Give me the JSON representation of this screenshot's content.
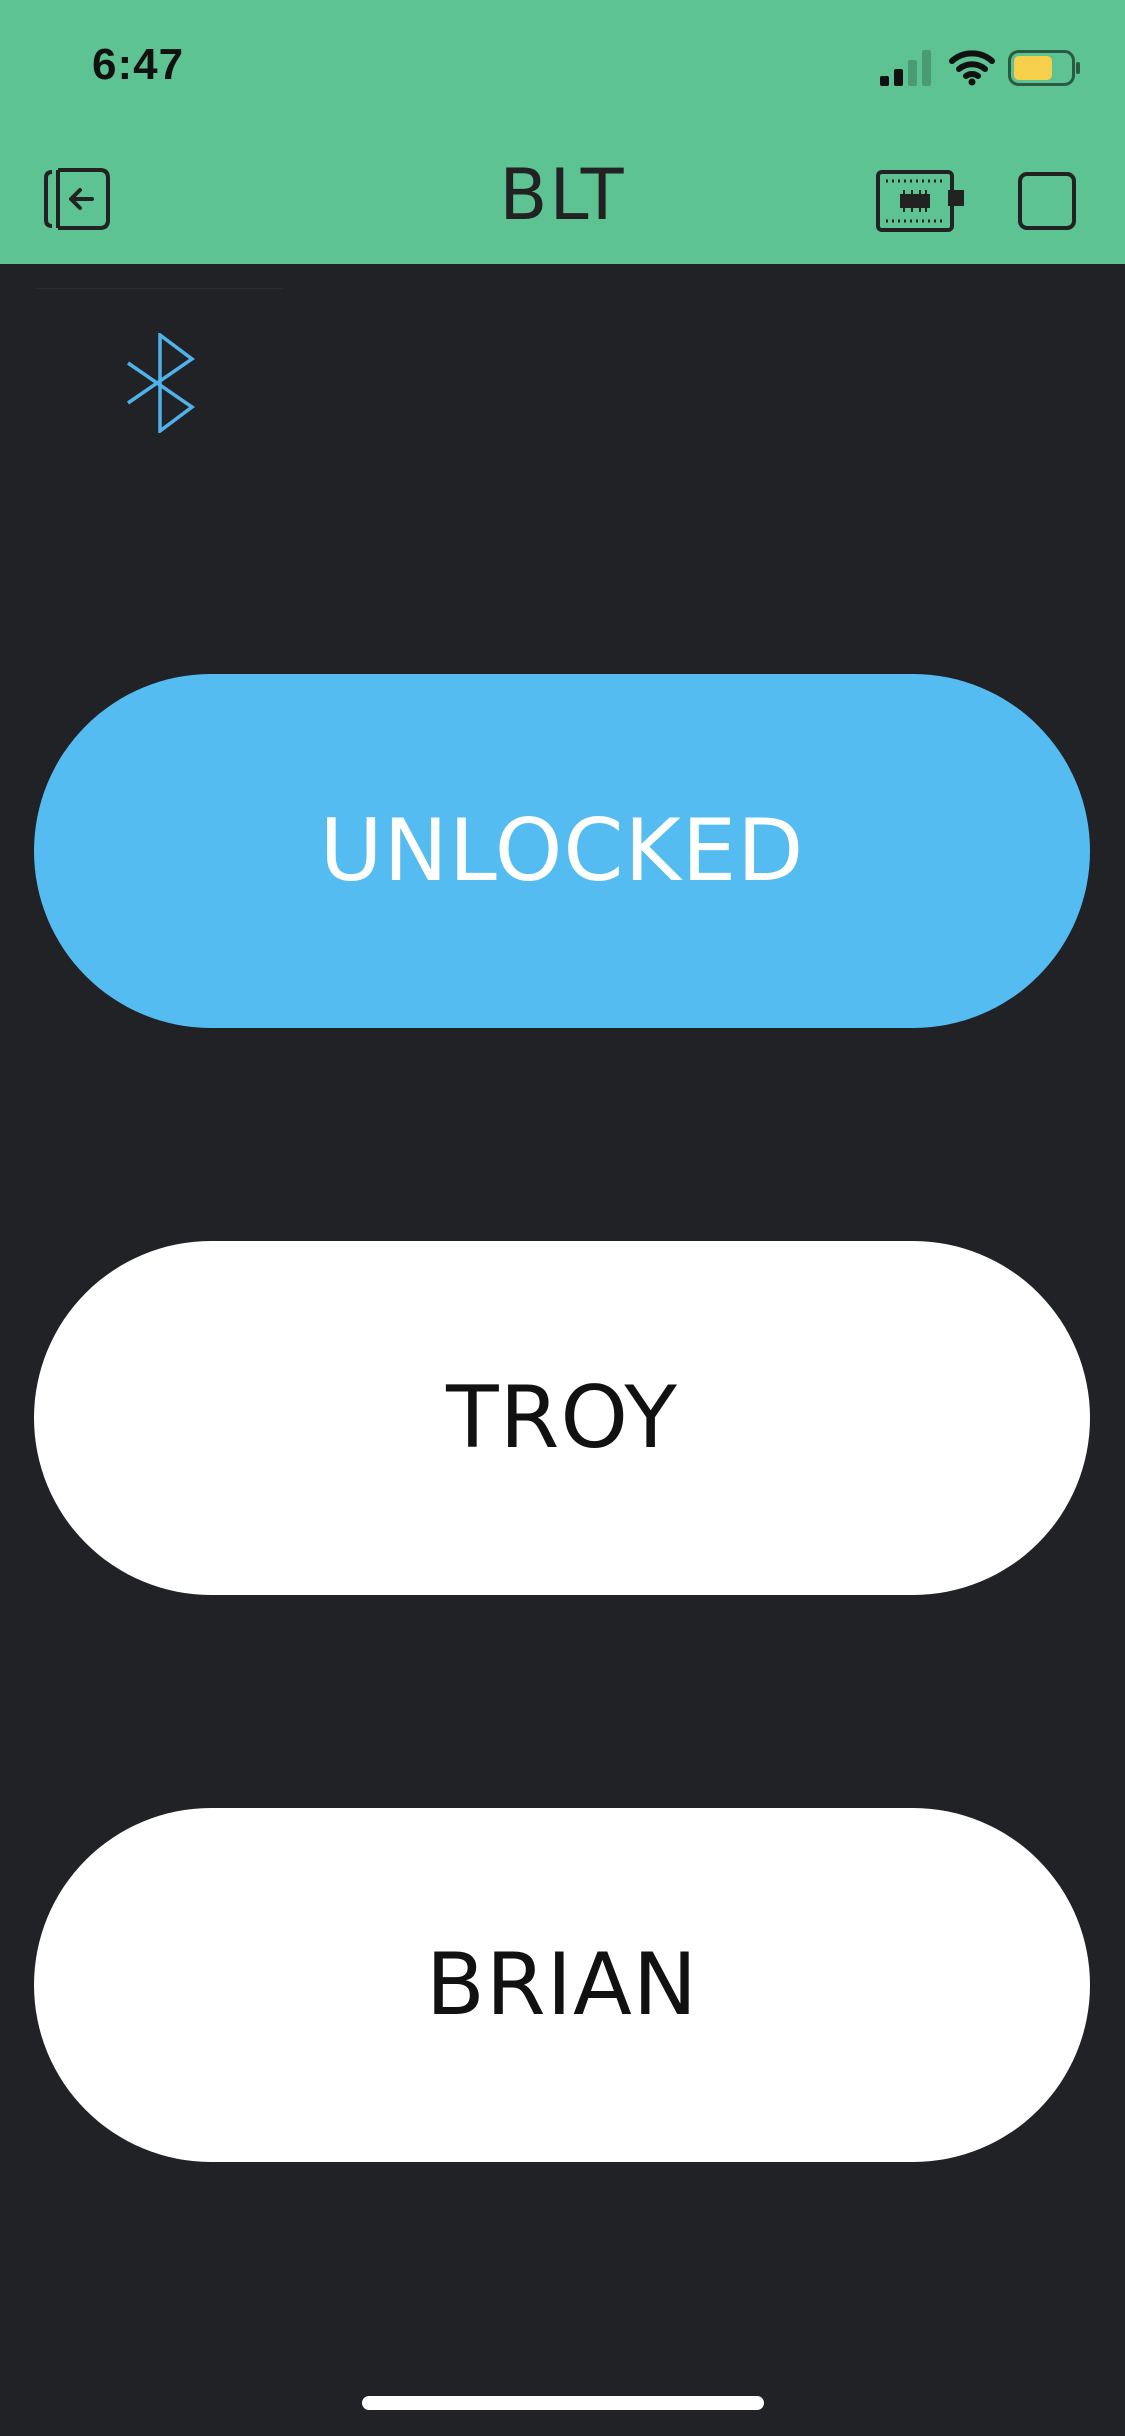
{
  "status_bar": {
    "time": "6:47",
    "battery_color": "#f6d04a"
  },
  "nav": {
    "title": "BLT",
    "left_icon": "exit-icon",
    "right_icons": [
      "device-board-icon",
      "square-icon"
    ]
  },
  "widgets": {
    "bluetooth_icon": "bluetooth-icon",
    "bluetooth_color": "#4fb2ea"
  },
  "buttons": [
    {
      "label": "UNLOCKED",
      "state": "on",
      "color": "#55bcf2",
      "text_color": "#ffffff"
    },
    {
      "label": "TROY",
      "state": "off",
      "color": "#ffffff",
      "text_color": "#111111"
    },
    {
      "label": "BRIAN",
      "state": "off",
      "color": "#ffffff",
      "text_color": "#111111"
    }
  ],
  "colors": {
    "header": "#5dc392",
    "background": "#212226"
  }
}
